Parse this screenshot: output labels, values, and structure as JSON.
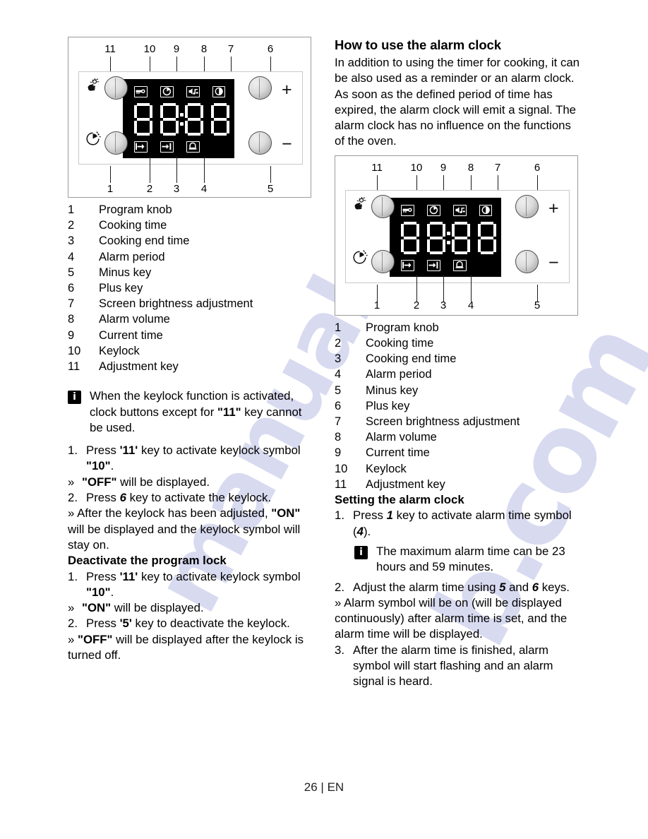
{
  "page": {
    "footer": "26 | EN",
    "watermark_1": "manualsli",
    "watermark_2": "b.com"
  },
  "diagram": {
    "top_callouts": [
      "11",
      "10",
      "9",
      "8",
      "7",
      "6"
    ],
    "bottom_callouts": [
      "1",
      "2",
      "3",
      "4",
      "5"
    ],
    "plus_label": "+",
    "minus_label": "−",
    "display_value": "88:88",
    "icons": {
      "top_left_panel": "hand-adjust-icon",
      "bottom_left_panel": "timer-clock-icon",
      "screen_top": [
        "keylock-icon",
        "current-time-clock-icon",
        "alarm-volume-icon",
        "screen-brightness-icon"
      ],
      "screen_bottom": [
        "cooking-time-icon",
        "cooking-end-time-icon",
        "alarm-bell-icon"
      ]
    }
  },
  "legend": {
    "items": [
      {
        "num": "1",
        "label": "Program knob"
      },
      {
        "num": "2",
        "label": "Cooking time"
      },
      {
        "num": "3",
        "label": "Cooking end time"
      },
      {
        "num": "4",
        "label": "Alarm period"
      },
      {
        "num": "5",
        "label": "Minus key"
      },
      {
        "num": "6",
        "label": "Plus key"
      },
      {
        "num": "7",
        "label": "Screen brightness adjustment"
      },
      {
        "num": "8",
        "label": "Alarm volume"
      },
      {
        "num": "9",
        "label": "Current time"
      },
      {
        "num": "10",
        "label": "Keylock"
      },
      {
        "num": "11",
        "label": "Adjustment key"
      }
    ]
  },
  "left_column": {
    "note": {
      "icon": "info-icon",
      "text_part1": "When the keylock function is activated, clock buttons except for ",
      "bold1": "\"11\"",
      "text_part2": " key cannot be used."
    },
    "step1": {
      "marker": "1.",
      "pre": "Press ",
      "b1": "'11'",
      "mid": " key to activate keylock symbol ",
      "b2": "\"10\"",
      "post": "."
    },
    "flow1": {
      "marker": "»",
      "b1": "\"OFF\"",
      "post": " will be displayed."
    },
    "step2": {
      "marker": "2.",
      "pre": "Press ",
      "b1": "6",
      "post": " key to activate the keylock."
    },
    "flow2": {
      "marker": "»",
      "pre": "After the keylock has been adjusted, ",
      "b1": "\"ON\"",
      "post": " will be displayed and the keylock symbol will stay on."
    },
    "subheading": "Deactivate the program lock",
    "step3": {
      "marker": "1.",
      "pre": "Press ",
      "b1": "'11'",
      "mid": " key to activate keylock symbol ",
      "b2": "\"10\"",
      "post": "."
    },
    "flow3": {
      "marker": "»",
      "b1": "\"ON\"",
      "post": " will be displayed."
    },
    "step4": {
      "marker": "2.",
      "pre": "Press ",
      "b1": "'5'",
      "post": " key to deactivate the keylock."
    },
    "flow4": {
      "marker": "»",
      "b1": "\"OFF\"",
      "post": " will be displayed after the keylock is turned off."
    }
  },
  "right_column": {
    "heading": "How to use the alarm clock",
    "intro1": "In addition to using the timer for cooking, it can be also used as a reminder or an alarm clock.",
    "intro2": "As soon as the defined period of time has expired, the alarm clock will emit a signal. The alarm clock has no influence on the functions of the oven.",
    "subheading": "Setting the alarm clock",
    "step1": {
      "marker": "1.",
      "pre": "Press ",
      "b1": "1",
      "mid": " key to activate alarm time symbol (",
      "b2": "4",
      "post": ")."
    },
    "note": {
      "icon": "info-icon",
      "text": "The maximum alarm time can be 23 hours and 59 minutes."
    },
    "step2": {
      "marker": "2.",
      "pre": "Adjust the alarm time using ",
      "b1": "5",
      "mid": " and ",
      "b2": "6",
      "post": " keys."
    },
    "flow1": {
      "marker": "»",
      "text": "Alarm symbol will be on (will be displayed continuously) after alarm time is set, and the alarm time will be displayed."
    },
    "step3": {
      "marker": "3.",
      "text": "After the alarm time is finished, alarm symbol will start flashing and an alarm signal is heard."
    }
  }
}
